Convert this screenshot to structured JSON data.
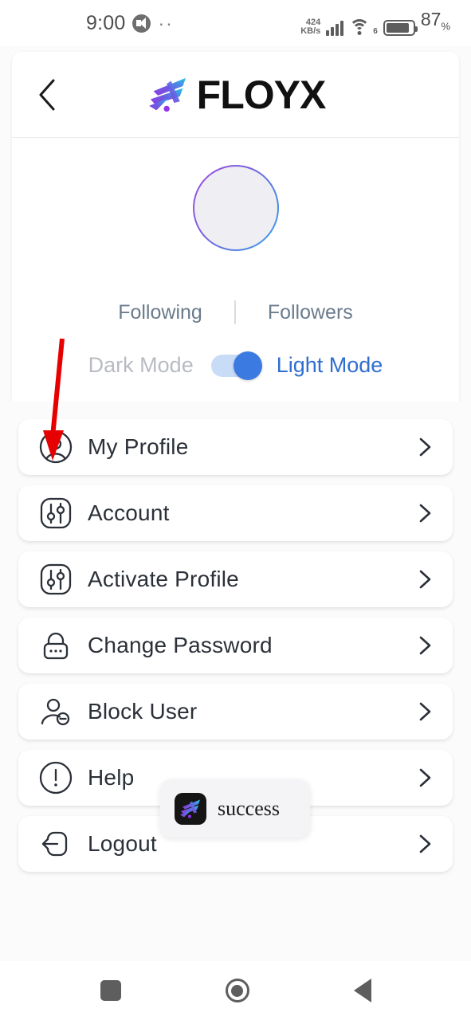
{
  "status_bar": {
    "time": "9:00",
    "mute_icon": "volume-mute-icon",
    "dots": "··",
    "network_speed_value": "424",
    "network_speed_unit": "KB/s",
    "signal_icon": "cellular-signal-icon",
    "wifi_icon": "wifi-icon",
    "wifi_generation": "6",
    "battery_icon": "battery-icon",
    "battery_percent": "87",
    "battery_percent_symbol": "%"
  },
  "header": {
    "back_icon": "chevron-left-icon",
    "brand_name": "FLOYX",
    "brand_mark": "floyx-logo-icon"
  },
  "profile": {
    "avatar": "user-avatar-placeholder",
    "following_label": "Following",
    "followers_label": "Followers",
    "dark_mode_label": "Dark Mode",
    "light_mode_label": "Light Mode",
    "theme_toggle_state": "light",
    "toggle_accent_color": "#3b7ae0",
    "toggle_track_color": "#c8dbf7"
  },
  "menu": {
    "items": [
      {
        "label": "My Profile",
        "icon": "user-circle-icon",
        "chevron": "chevron-right-icon"
      },
      {
        "label": "Account",
        "icon": "sliders-icon",
        "chevron": "chevron-right-icon"
      },
      {
        "label": "Activate Profile",
        "icon": "sliders-icon",
        "chevron": "chevron-right-icon"
      },
      {
        "label": "Change Password",
        "icon": "lock-icon",
        "chevron": "chevron-right-icon"
      },
      {
        "label": "Block User",
        "icon": "user-minus-icon",
        "chevron": "chevron-right-icon"
      },
      {
        "label": "Help",
        "icon": "exclamation-circle-icon",
        "chevron": "chevron-right-icon"
      },
      {
        "label": "Logout",
        "icon": "logout-icon",
        "chevron": "chevron-right-icon"
      }
    ]
  },
  "toast": {
    "message": "success",
    "app_icon": "floyx-app-icon"
  },
  "annotation": {
    "arrow_color": "#e60000",
    "arrow_target": "my-profile-row"
  },
  "navbar": {
    "recents_icon": "square-recents-icon",
    "home_icon": "circle-home-icon",
    "back_icon": "triangle-back-icon"
  }
}
